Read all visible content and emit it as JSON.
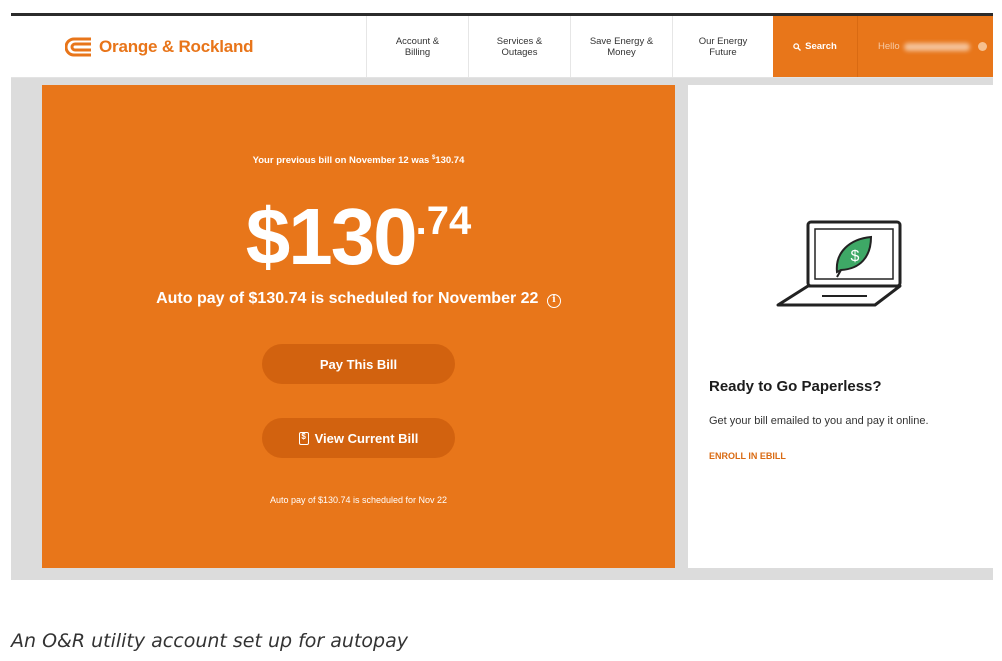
{
  "header": {
    "logo_text": "Orange & Rockland",
    "nav": [
      {
        "label": "Account &\nBilling"
      },
      {
        "label": "Services &\nOutages"
      },
      {
        "label": "Save Energy &\nMoney"
      },
      {
        "label": "Our Energy\nFuture"
      }
    ],
    "search_label": "Search",
    "hello_label": "Hello"
  },
  "bill": {
    "prev_text_pre": "Your previous bill on November 12 was ",
    "prev_currency": "$",
    "prev_amount": "130.74",
    "amount_dollars": "$130",
    "amount_cents": ".74",
    "autopay_text": "Auto pay of $130.74 is scheduled for November 22",
    "info_icon_glyph": "i",
    "pay_button": "Pay This Bill",
    "view_button": "View Current Bill",
    "autopay_small": "Auto pay of $130.74 is scheduled for Nov 22"
  },
  "paperless": {
    "title": "Ready to Go Paperless?",
    "text": "Get your bill emailed to you and pay it online.",
    "link": "ENROLL IN EBILL",
    "leaf_symbol": "$"
  },
  "caption": "An O&R utility account set up for autopay",
  "colors": {
    "brand_orange": "#e8761a",
    "button_orange": "#d2620f",
    "leaf_green": "#3ea866"
  },
  "icons": [
    "logo-mark-icon",
    "search-icon",
    "info-icon",
    "bill-document-icon",
    "laptop-leaf-icon"
  ]
}
